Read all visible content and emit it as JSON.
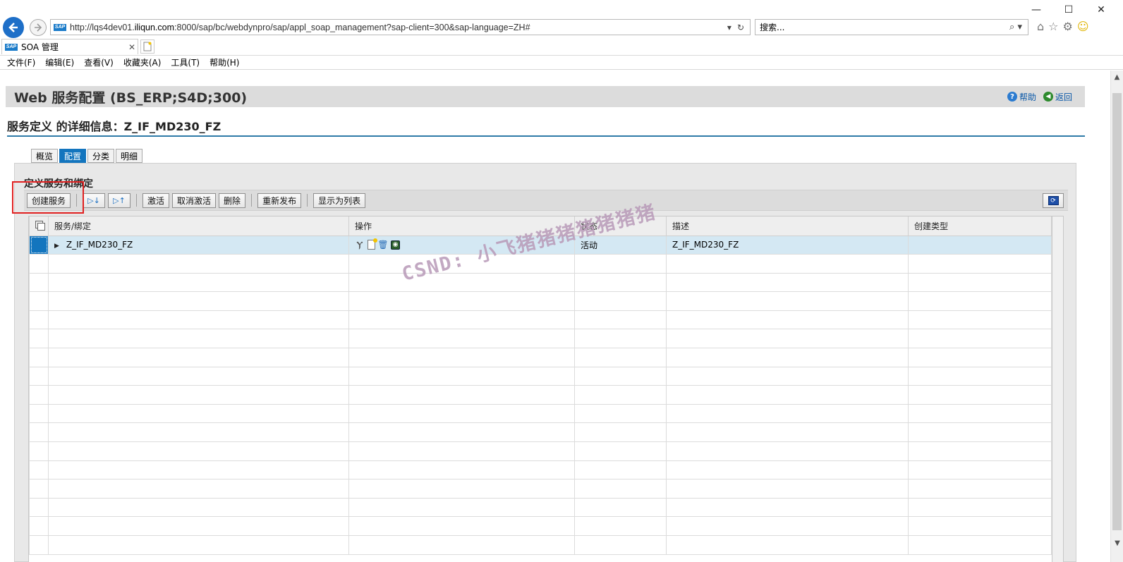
{
  "browser": {
    "url_prefix": "http://lqs4dev01.",
    "url_domain": "iliqun.com",
    "url_suffix": ":8000/sap/bc/webdynpro/sap/appl_soap_management?sap-client=300&sap-language=ZH#",
    "search_placeholder": "搜索...",
    "tab_title": "SOA 管理",
    "favicon_text": "SAP",
    "menu": [
      "文件(F)",
      "编辑(E)",
      "查看(V)",
      "收藏夹(A)",
      "工具(T)",
      "帮助(H)"
    ]
  },
  "header": {
    "title": "Web 服务配置 (BS_ERP;S4D;300)",
    "help_label": "帮助",
    "back_label": "返回"
  },
  "detail_title": "服务定义 的详细信息：Z_IF_MD230_FZ",
  "tabs": [
    {
      "label": "概览",
      "active": false
    },
    {
      "label": "配置",
      "active": true
    },
    {
      "label": "分类",
      "active": false
    },
    {
      "label": "明细",
      "active": false
    }
  ],
  "panel": {
    "title": "定义服务和绑定",
    "toolbar": {
      "create_service": "创建服务",
      "activate": "激活",
      "deactivate": "取消激活",
      "delete": "删除",
      "republish": "重新发布",
      "show_as_list": "显示为列表"
    }
  },
  "table": {
    "columns": [
      "服务/绑定",
      "操作",
      "状态",
      "描述",
      "创建类型"
    ],
    "rows": [
      {
        "name": "Z_IF_MD230_FZ",
        "status": "活动",
        "description": "Z_IF_MD230_FZ",
        "creation_type": "",
        "selected": true,
        "operations": [
          "binding-icon",
          "new-document-icon",
          "trash-icon",
          "view-icon"
        ]
      }
    ],
    "empty_rows": 16
  },
  "watermark": "CSND: 小飞猪猪猪猪猪猪猪",
  "colors": {
    "accent_blue": "#1375be",
    "header_gray": "#dcdcdc",
    "selected_row": "#d4e8f3",
    "highlight_red": "#e02020"
  }
}
